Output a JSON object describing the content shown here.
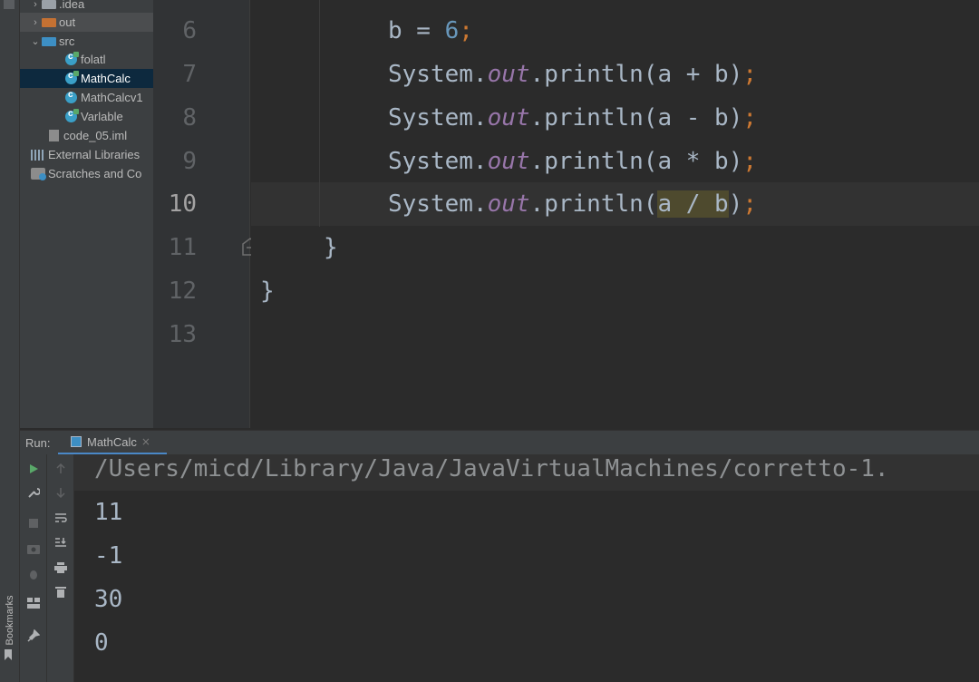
{
  "project_tree": {
    "items": [
      {
        "label": ".idea",
        "kind": "folder-grey",
        "arrow": "›"
      },
      {
        "label": "out",
        "kind": "folder-orange",
        "arrow": "›"
      },
      {
        "label": "src",
        "kind": "folder-blue",
        "arrow": "⌄"
      },
      {
        "label": "folatl",
        "kind": "class-run"
      },
      {
        "label": "MathCalc",
        "kind": "class-run"
      },
      {
        "label": "MathCalcv1",
        "kind": "class"
      },
      {
        "label": "Varlable",
        "kind": "class-run"
      },
      {
        "label": "code_05.iml",
        "kind": "file"
      },
      {
        "label": "External Libraries",
        "kind": "lib"
      },
      {
        "label": "Scratches and Co",
        "kind": "scratch"
      }
    ]
  },
  "editor": {
    "line_numbers": [
      "6",
      "7",
      "8",
      "9",
      "10",
      "11",
      "12",
      "13"
    ],
    "current_line": "10",
    "code": {
      "l6_b": "b = ",
      "l6_num": "6",
      "l6_semi": ";",
      "sys": "System.",
      "out": "out",
      "println": ".println(",
      "l7_args": "a + b)",
      "l8_args": "a - b)",
      "l9_args": "a * b)",
      "l10_a": "a / b",
      "l10_close": ")",
      "semi": ";",
      "l11": "}",
      "l12": "}"
    }
  },
  "run_panel": {
    "label": "Run:",
    "tab_label": "MathCalc",
    "tab_close": "×",
    "command": "/Users/micd/Library/Java/JavaVirtualMachines/corretto-1.",
    "output": [
      "11",
      "-1",
      "30",
      "0"
    ]
  },
  "sidebar": {
    "bookmarks_label": "Bookmarks"
  }
}
